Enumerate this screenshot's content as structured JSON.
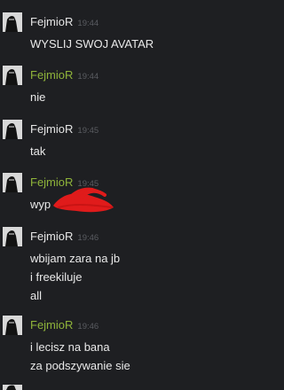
{
  "messages": [
    {
      "author": "FejmioR",
      "time": "19:44",
      "lines": [
        "WYSLIJ SWOJ AVATAR"
      ]
    },
    {
      "author": "FejmioR",
      "time": "19:44",
      "lines": [
        "nie"
      ]
    },
    {
      "author": "FejmioR",
      "time": "19:45",
      "lines": [
        "tak"
      ]
    },
    {
      "author": "FejmioR",
      "time": "19:45",
      "lines": [
        "wyp"
      ]
    },
    {
      "author": "FejmioR",
      "time": "19:46",
      "lines": [
        "wbijam zara na jb",
        "i freekiluje",
        "all"
      ]
    },
    {
      "author": "FejmioR",
      "time": "19:46",
      "lines": [
        "i lecisz na bana",
        "za podszywanie sie"
      ]
    }
  ],
  "colors": {
    "background": "#1e1f22",
    "name_white": "#e6e6e6",
    "name_green": "#8fb43a",
    "timestamp": "#5a5c61",
    "text": "#e9e9e9",
    "redaction": "#e01b1b"
  },
  "icons": {
    "avatar": "avatar-icon",
    "redaction": "red-scribble-redaction"
  }
}
